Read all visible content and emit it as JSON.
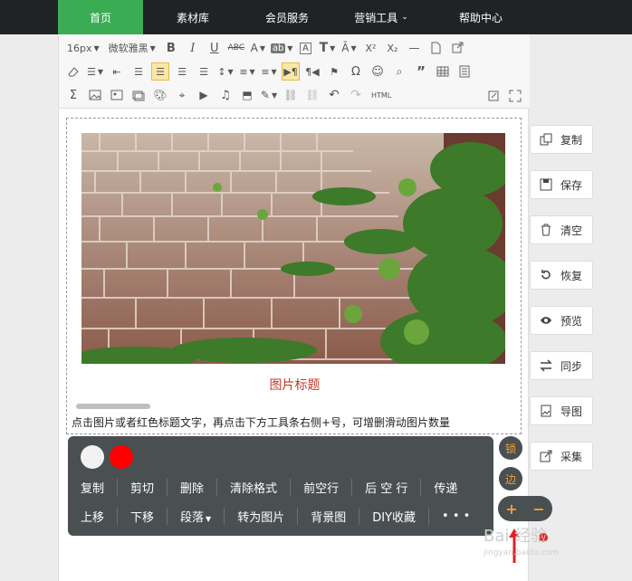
{
  "nav": {
    "items": [
      {
        "label": "首页"
      },
      {
        "label": "素材库"
      },
      {
        "label": "会员服务"
      },
      {
        "label": "营销工具"
      },
      {
        "label": "帮助中心"
      }
    ]
  },
  "toolbar": {
    "font_size": "16px",
    "font_family": "微软雅黑",
    "html_label": "HTML"
  },
  "content": {
    "caption": "图片标题",
    "hint": "点击图片或者红色标题文字，再点击下方工具条右侧+号，可增删滑动图片数量"
  },
  "panel": {
    "swatches": [
      "#f2f2f2",
      "#ff0000"
    ],
    "row1": [
      "复制",
      "剪切",
      "删除",
      "清除格式",
      "前空行",
      "后 空 行",
      "传递"
    ],
    "row2": [
      "上移",
      "下移",
      "段落",
      "转为图片",
      "背景图",
      "DIY收藏",
      "• • •"
    ],
    "lock": "锁",
    "edge": "边",
    "plus": "+",
    "minus": "−"
  },
  "side": {
    "buttons": [
      {
        "label": "复制",
        "icon": "copy-icon"
      },
      {
        "label": "保存",
        "icon": "save-icon"
      },
      {
        "label": "清空",
        "icon": "trash-icon"
      },
      {
        "label": "恢复",
        "icon": "undo-icon"
      },
      {
        "label": "预览",
        "icon": "eye-icon"
      },
      {
        "label": "同步",
        "icon": "sync-icon"
      },
      {
        "label": "导图",
        "icon": "image-export-icon"
      },
      {
        "label": "采集",
        "icon": "collect-icon"
      }
    ]
  },
  "watermark": {
    "text": "Bai 经验",
    "sub": "jingyan.baidu.com"
  },
  "colors": {
    "nav_bg": "#1f2324",
    "nav_active": "#3aac54",
    "caption": "#c0392b",
    "panel_bg": "#4a4f52",
    "accent": "#f0a030"
  }
}
